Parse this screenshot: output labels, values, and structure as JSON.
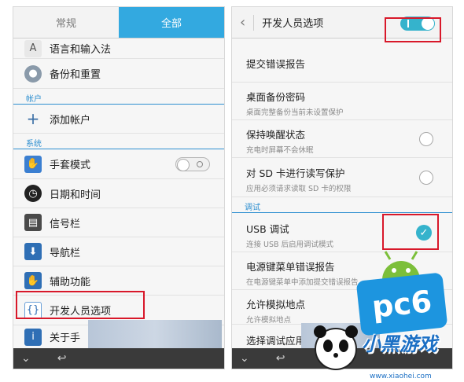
{
  "left": {
    "tabs": [
      "常规",
      "全部"
    ],
    "items": [
      {
        "label": "语言和输入法",
        "icon": "language-icon"
      },
      {
        "label": "备份和重置",
        "icon": "backup-icon"
      },
      {
        "label": "添加帐户",
        "icon": "add-icon"
      },
      {
        "label": "手套模式",
        "icon": "glove-icon"
      },
      {
        "label": "日期和时间",
        "icon": "clock-icon"
      },
      {
        "label": "信号栏",
        "icon": "signal-bar-icon"
      },
      {
        "label": "导航栏",
        "icon": "navigation-bar-icon"
      },
      {
        "label": "辅助功能",
        "icon": "hand-icon"
      },
      {
        "label": "开发人员选项",
        "icon": "braces-icon"
      },
      {
        "label": "关于手",
        "icon": "info-icon"
      }
    ],
    "sections": [
      "帐户",
      "系统"
    ]
  },
  "right": {
    "title": "开发人员选项",
    "items": [
      {
        "title": "提交错误报告",
        "sub": ""
      },
      {
        "title": "桌面备份密码",
        "sub": "桌面完整备份当前未设置保护"
      },
      {
        "title": "保持唤醒状态",
        "sub": "充电时屏幕不会休眠"
      },
      {
        "title": "对 SD 卡进行读写保护",
        "sub": "应用必须请求读取 SD 卡的权限"
      },
      {
        "title": "USB 调试",
        "sub": "连接 USB 后启用调试模式"
      },
      {
        "title": "电源键菜单错误报告",
        "sub": "在电源键菜单中添加提交错误报告"
      },
      {
        "title": "允许模拟地点",
        "sub": "允许模拟地点"
      },
      {
        "title": "选择调试应用",
        "sub": ""
      }
    ],
    "section": "调试"
  },
  "watermark": {
    "brand": "pc6",
    "text": "小黑游戏",
    "url": "www.xiaohei.com"
  }
}
